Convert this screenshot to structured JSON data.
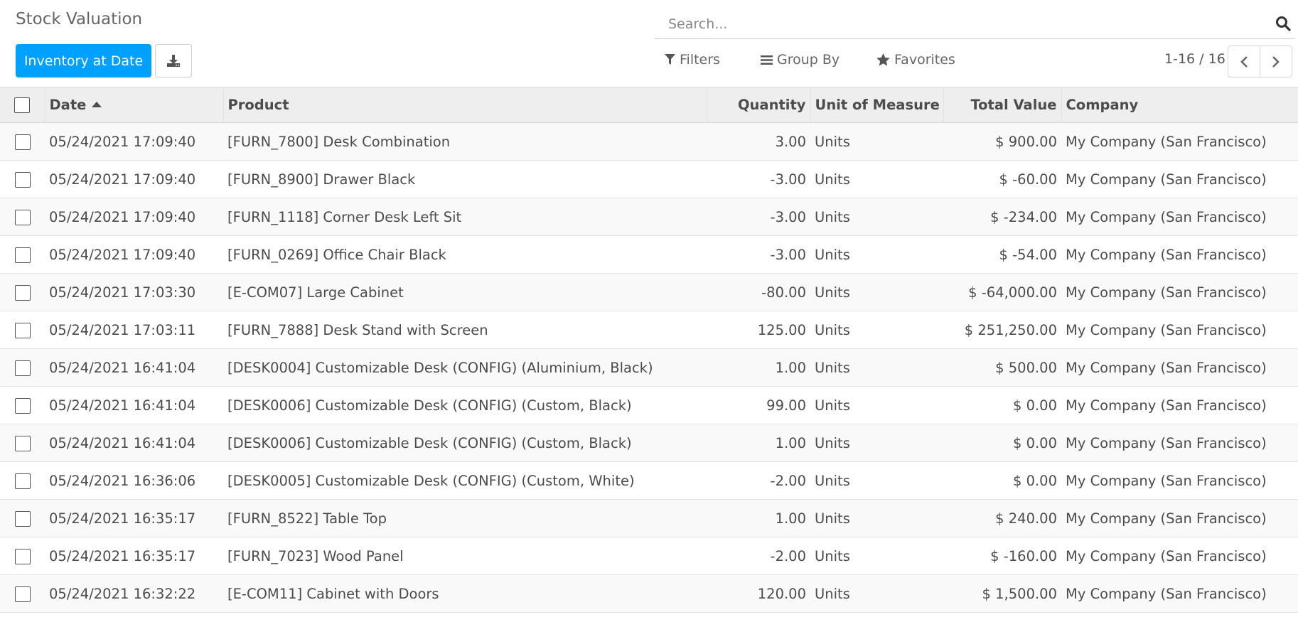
{
  "control_panel": {
    "title": "Stock Valuation",
    "inventory_button": "Inventory at Date",
    "search_placeholder": "Search...",
    "filters_label": "Filters",
    "group_by_label": "Group By",
    "favorites_label": "Favorites",
    "pager_value": "1-16 / 16"
  },
  "icons": {
    "download": "download-icon",
    "search": "search-icon",
    "filter": "filter-icon",
    "group_by": "list-icon",
    "favorites": "star-icon",
    "prev": "chevron-left-icon",
    "next": "chevron-right-icon"
  },
  "colors": {
    "primary": "#00a0ff",
    "header_bg": "#eeeeee",
    "row_alt": "#f9f9f9",
    "text": "#4c4c4c"
  },
  "table": {
    "columns": {
      "date": "Date",
      "product": "Product",
      "quantity": "Quantity",
      "uom": "Unit of Measure",
      "total_value": "Total Value",
      "company": "Company"
    },
    "rows": [
      {
        "date": "05/24/2021 17:09:40",
        "product": "[FURN_7800] Desk Combination",
        "quantity": "3.00",
        "uom": "Units",
        "total_value": "$ 900.00",
        "company": "My Company (San Francisco)"
      },
      {
        "date": "05/24/2021 17:09:40",
        "product": "[FURN_8900] Drawer Black",
        "quantity": "-3.00",
        "uom": "Units",
        "total_value": "$ -60.00",
        "company": "My Company (San Francisco)"
      },
      {
        "date": "05/24/2021 17:09:40",
        "product": "[FURN_1118] Corner Desk Left Sit",
        "quantity": "-3.00",
        "uom": "Units",
        "total_value": "$ -234.00",
        "company": "My Company (San Francisco)"
      },
      {
        "date": "05/24/2021 17:09:40",
        "product": "[FURN_0269] Office Chair Black",
        "quantity": "-3.00",
        "uom": "Units",
        "total_value": "$ -54.00",
        "company": "My Company (San Francisco)"
      },
      {
        "date": "05/24/2021 17:03:30",
        "product": "[E-COM07] Large Cabinet",
        "quantity": "-80.00",
        "uom": "Units",
        "total_value": "$ -64,000.00",
        "company": "My Company (San Francisco)"
      },
      {
        "date": "05/24/2021 17:03:11",
        "product": "[FURN_7888] Desk Stand with Screen",
        "quantity": "125.00",
        "uom": "Units",
        "total_value": "$ 251,250.00",
        "company": "My Company (San Francisco)"
      },
      {
        "date": "05/24/2021 16:41:04",
        "product": "[DESK0004] Customizable Desk (CONFIG) (Aluminium, Black)",
        "quantity": "1.00",
        "uom": "Units",
        "total_value": "$ 500.00",
        "company": "My Company (San Francisco)"
      },
      {
        "date": "05/24/2021 16:41:04",
        "product": "[DESK0006] Customizable Desk (CONFIG) (Custom, Black)",
        "quantity": "99.00",
        "uom": "Units",
        "total_value": "$ 0.00",
        "company": "My Company (San Francisco)"
      },
      {
        "date": "05/24/2021 16:41:04",
        "product": "[DESK0006] Customizable Desk (CONFIG) (Custom, Black)",
        "quantity": "1.00",
        "uom": "Units",
        "total_value": "$ 0.00",
        "company": "My Company (San Francisco)"
      },
      {
        "date": "05/24/2021 16:36:06",
        "product": "[DESK0005] Customizable Desk (CONFIG) (Custom, White)",
        "quantity": "-2.00",
        "uom": "Units",
        "total_value": "$ 0.00",
        "company": "My Company (San Francisco)"
      },
      {
        "date": "05/24/2021 16:35:17",
        "product": "[FURN_8522] Table Top",
        "quantity": "1.00",
        "uom": "Units",
        "total_value": "$ 240.00",
        "company": "My Company (San Francisco)"
      },
      {
        "date": "05/24/2021 16:35:17",
        "product": "[FURN_7023] Wood Panel",
        "quantity": "-2.00",
        "uom": "Units",
        "total_value": "$ -160.00",
        "company": "My Company (San Francisco)"
      },
      {
        "date": "05/24/2021 16:32:22",
        "product": "[E-COM11] Cabinet with Doors",
        "quantity": "120.00",
        "uom": "Units",
        "total_value": "$ 1,500.00",
        "company": "My Company (San Francisco)"
      }
    ]
  }
}
